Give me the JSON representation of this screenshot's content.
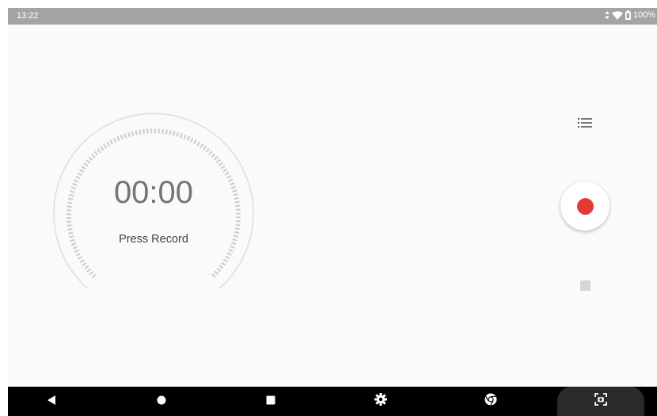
{
  "status_bar": {
    "time": "13:22",
    "battery": "100%",
    "icons": [
      "data-arrows-icon",
      "wifi-icon",
      "battery-icon"
    ]
  },
  "recorder": {
    "timer": "00:00",
    "hint": "Press Record"
  },
  "controls": {
    "list_icon": "list-icon",
    "record_icon": "record-icon",
    "stop_icon": "stop-icon"
  },
  "nav_bar": {
    "items": [
      "back-icon",
      "home-icon",
      "recents-icon",
      "settings-icon",
      "chrome-icon",
      "screenshot-icon"
    ]
  },
  "colors": {
    "record_red": "#e53935",
    "status_bar": "#a4a4a4",
    "nav_bar": "#000000",
    "timer_text": "#757575"
  }
}
